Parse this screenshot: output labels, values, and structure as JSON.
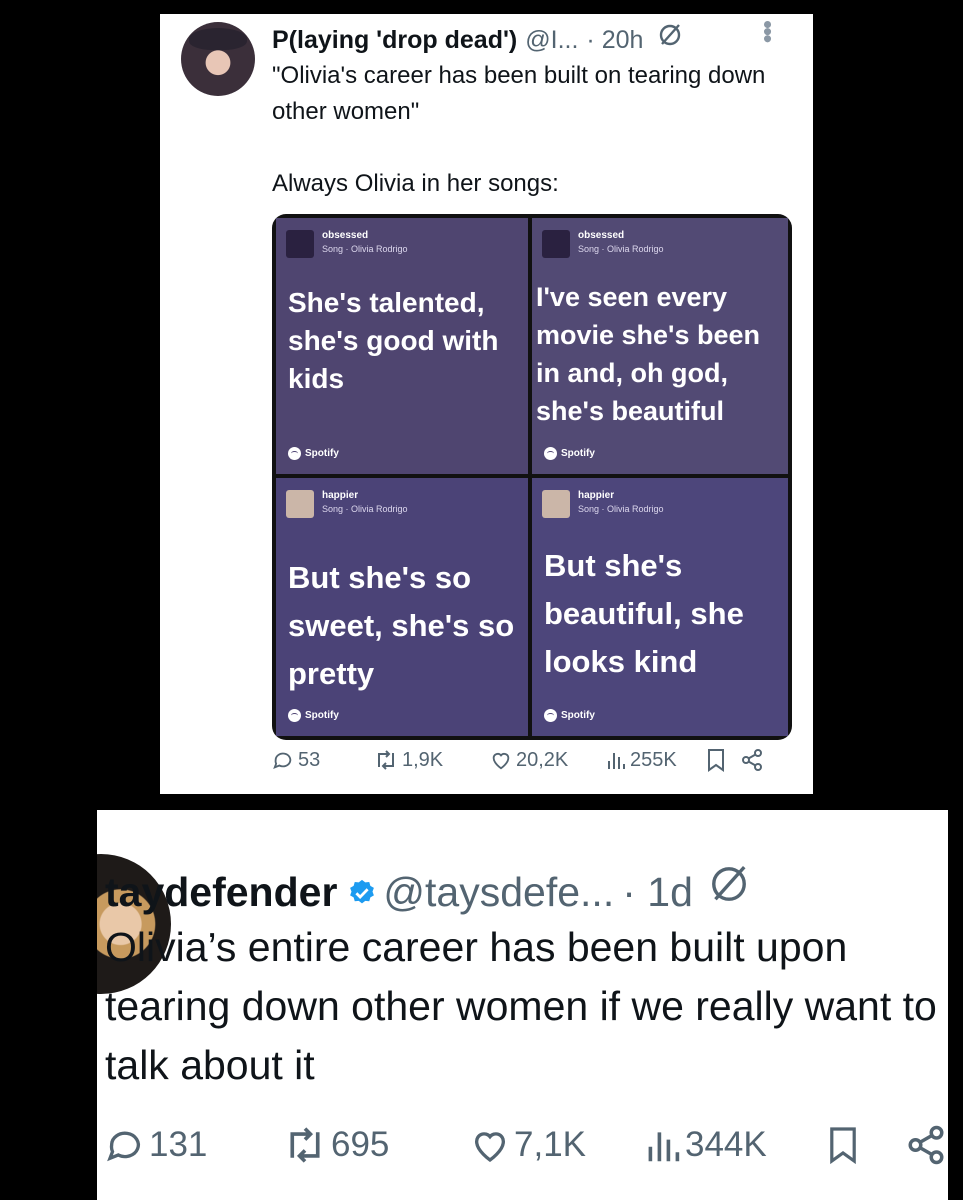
{
  "tweet1": {
    "name": "P(laying 'drop dead')",
    "handle": "@I...",
    "time": "· 20h",
    "more_icon": "more-dots-icon",
    "text": "\"Olivia's career has been built on tearing down other women\"\n\nAlways Olivia in her songs:",
    "cards": [
      {
        "song": "obsessed",
        "artist": "Song · Olivia Rodrigo",
        "lyric": "She's talented, she's good with kids",
        "brand": "Spotify"
      },
      {
        "song": "obsessed",
        "artist": "Song · Olivia Rodrigo",
        "lyric": "I've seen every movie she's been in and, oh god, she's beautiful",
        "brand": "Spotify"
      },
      {
        "song": "happier",
        "artist": "Song · Olivia Rodrigo",
        "lyric": "But she's so sweet, she's so pretty",
        "brand": "Spotify"
      },
      {
        "song": "happier",
        "artist": "Song · Olivia Rodrigo",
        "lyric": "But she's beautiful, she looks kind",
        "brand": "Spotify"
      }
    ],
    "actions": {
      "replies": "53",
      "reposts": "1,9K",
      "likes": "20,2K",
      "views": "255K"
    }
  },
  "tweet2": {
    "name": "taydefender",
    "handle": "@taysdefe...",
    "time": "· 1d",
    "text": "Olivia’s entire career has been built upon tearing down other women if we really want to talk about it",
    "actions": {
      "replies": "131",
      "reposts": "695",
      "likes": "7,1K",
      "views": "344K"
    }
  },
  "colors": {
    "card_bg": "#4e4573",
    "verified": "#1d9bf0",
    "muted": "#536471"
  }
}
